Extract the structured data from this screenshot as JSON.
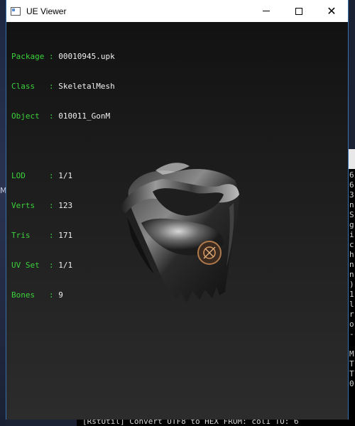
{
  "window": {
    "title": "UE Viewer",
    "controls": {
      "minimize": "—",
      "maximize": "☐",
      "close": "✕"
    }
  },
  "info": {
    "package_key": "Package",
    "package_value": "00010945.upk",
    "class_key": "Class  ",
    "class_value": "SkeletalMesh",
    "object_key": "Object ",
    "object_value": "010011_GonM",
    "lod_key": "LOD    ",
    "lod_value": "1/1",
    "verts_key": "Verts  ",
    "verts_value": "123",
    "tris_key": "Tris   ",
    "tris_value": "171",
    "uvset_key": "UV Set ",
    "uvset_value": "1/1",
    "bones_key": "Bones  ",
    "bones_value": "9",
    "separator": ": "
  },
  "background": {
    "left_glyph": "M",
    "right_column": [
      "6",
      "6",
      "3",
      "n",
      "S",
      "g",
      "i",
      "c",
      "h",
      "n",
      "n",
      ")",
      "1",
      "l",
      "r",
      "o",
      "-",
      "",
      "M",
      "T",
      "T",
      "0"
    ],
    "bottom_text": "[RstUtil] Convert UTF8 to HEX  FROM: col1  TO: 6"
  },
  "colors": {
    "label_green": "#3bd13b",
    "value_white": "#f0f0f0",
    "viewport_bg": "#1c1c1c"
  }
}
